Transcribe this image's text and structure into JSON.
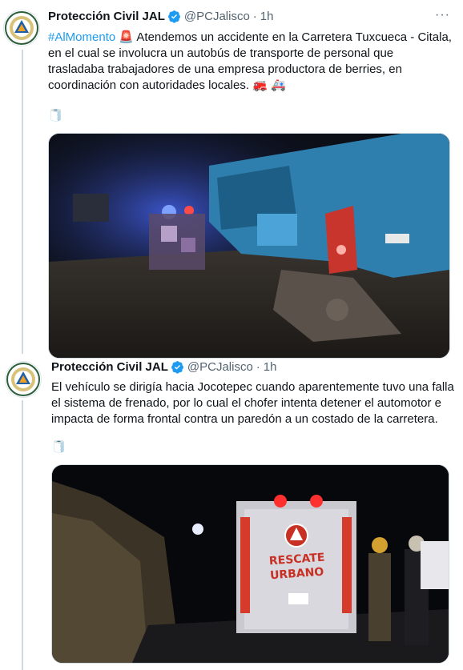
{
  "tweets": [
    {
      "author_name": "Protección Civil JAL",
      "handle": "@PCJalisco",
      "separator": "·",
      "time": "1h",
      "more": "···",
      "hashtag": "#AlMomento",
      "siren_emoji": "🚨",
      "text": " Atendemos un accidente en la Carretera Tuxcueca - Citala, en el cual se involucra un autobús de transporte de personal  que trasladaba trabajadores de una empresa productora de berries, en coordinación con autoridades locales. ",
      "trailing_emojis": "🚒 🚑",
      "extra_emoji": "🧻",
      "media_alt": "Autobús accidentado en la carretera de noche"
    },
    {
      "author_name": "Protección Civil JAL",
      "handle": "@PCJalisco",
      "separator": "·",
      "time": "1h",
      "text": "El vehículo se dirigía hacia Jocotepec cuando aparentemente tuvo una falla el sistema de frenado, por lo cual el chofer intenta detener el automotor e impacta de forma frontal contra un paredón a un costado de la carretera.",
      "extra_emoji": "🧻",
      "media_alt": "Camión de Rescate Urbano en la escena del accidente",
      "truck_label_1": "RESCATE",
      "truck_label_2": "URBANO"
    }
  ],
  "colors": {
    "link": "#1d9bf0",
    "secondary_text": "#536471",
    "thread_line": "#cfd9de"
  }
}
